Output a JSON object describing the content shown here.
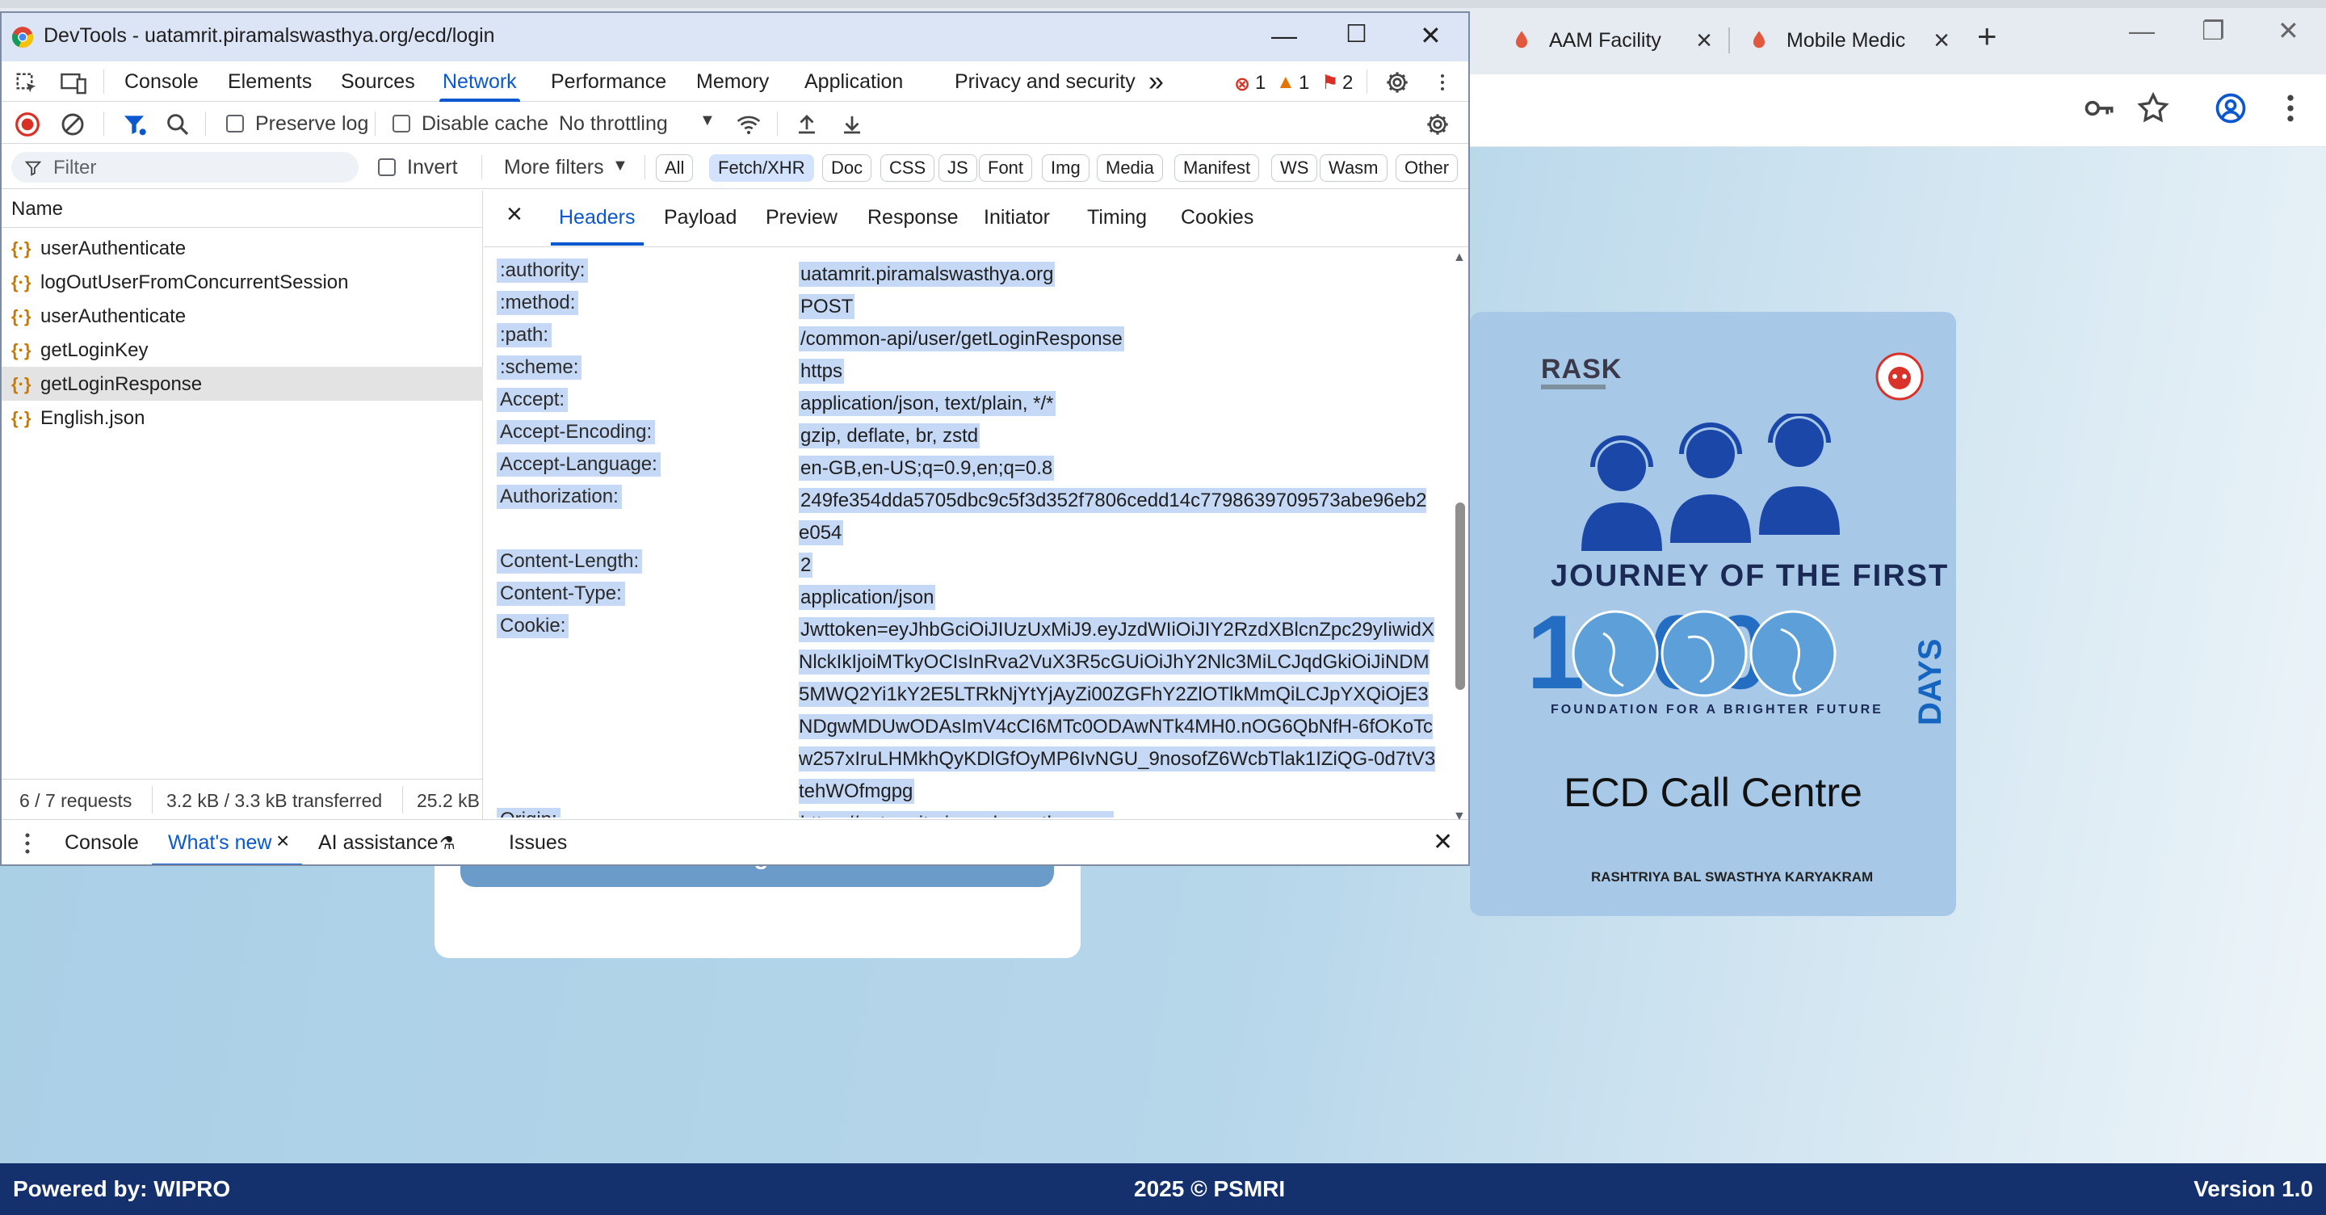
{
  "browser": {
    "tabs": [
      {
        "label": "AAM Facility"
      },
      {
        "label": "Mobile Medic"
      }
    ],
    "new_tab": "+",
    "win_min": "—",
    "win_restore": "❐",
    "win_close": "✕"
  },
  "page": {
    "login_button": "Login",
    "ecd": {
      "logo_text": "RASK",
      "journey": "JOURNEY OF THE FIRST",
      "number": "1000",
      "days": "DAYS",
      "foundation": "FOUNDATION FOR A BRIGHTER FUTURE",
      "title": "ECD Call Centre",
      "program": "RASHTRIYA BAL SWASTHYA KARYAKRAM"
    },
    "footer": {
      "powered": "Powered by: WIPRO",
      "copyright": "2025 © PSMRI",
      "version": "Version 1.0"
    }
  },
  "devtools": {
    "title": "DevTools - uatamrit.piramalswasthya.org/ecd/login",
    "main_tabs": [
      "Console",
      "Elements",
      "Sources",
      "Network",
      "Performance",
      "Memory",
      "Application",
      "Privacy and security"
    ],
    "more_tabs": "»",
    "errors": "1",
    "warnings": "1",
    "issues": "2",
    "network_bar": {
      "preserve_log": "Preserve log",
      "disable_cache": "Disable cache",
      "throttling": "No throttling"
    },
    "filter_bar": {
      "filter_placeholder": "Filter",
      "invert": "Invert",
      "more_filters": "More filters",
      "chips": [
        "All",
        "Fetch/XHR",
        "Doc",
        "CSS",
        "JS",
        "Font",
        "Img",
        "Media",
        "Manifest",
        "WS",
        "Wasm",
        "Other"
      ]
    },
    "requests": {
      "column": "Name",
      "items": [
        "userAuthenticate",
        "logOutUserFromConcurrentSession",
        "userAuthenticate",
        "getLoginKey",
        "getLoginResponse",
        "English.json"
      ],
      "status": {
        "count": "6 / 7 requests",
        "transferred": "3.2 kB / 3.3 kB transferred",
        "resources": "25.2 kB"
      }
    },
    "detail_tabs": [
      "Headers",
      "Payload",
      "Preview",
      "Response",
      "Initiator",
      "Timing",
      "Cookies"
    ],
    "headers": [
      {
        "name": ":authority:",
        "value": "uatamrit.piramalswasthya.org"
      },
      {
        "name": ":method:",
        "value": "POST"
      },
      {
        "name": ":path:",
        "value": "/common-api/user/getLoginResponse"
      },
      {
        "name": ":scheme:",
        "value": "https"
      },
      {
        "name": "Accept:",
        "value": "application/json, text/plain, */*"
      },
      {
        "name": "Accept-Encoding:",
        "value": "gzip, deflate, br, zstd"
      },
      {
        "name": "Accept-Language:",
        "value": "en-GB,en-US;q=0.9,en;q=0.8"
      },
      {
        "name": "Authorization:",
        "value": "249fe354dda5705dbc9c5f3d352f7806cedd14c7798639709573abe96eb2e054"
      },
      {
        "name": "Content-Length:",
        "value": "2"
      },
      {
        "name": "Content-Type:",
        "value": "application/json"
      },
      {
        "name": "Cookie:",
        "value": "Jwttoken=eyJhbGciOiJIUzUxMiJ9.eyJzdWIiOiJIY2RzdXBlcnZpc29yIiwidXNlckIkIjoiMTkyOCIsInRva2VuX3R5cGUiOiJhY2Nlc3MiLCJqdGkiOiJiNDM5MWQ2Yi1kY2E5LTRkNjYtYjAyZi00ZGFhY2ZlOTlkMmQiLCJpYXQiOjE3NDgwMDUwODAsImV4cCI6MTc0ODAwNTk4MH0.nOG6QbNfH-6fOKoTcw257xIruLHMkhQyKDlGfOyMP6IvNGU_9nosofZ6WcbTlak1IZiQG-0d7tV3tehWOfmgpg"
      },
      {
        "name": "Origin:",
        "value": "https://uatamrit.piramalswasthya.org"
      }
    ],
    "drawer": {
      "tabs": [
        "Console",
        "What's new",
        "AI assistance",
        "Issues"
      ],
      "close": "✕"
    }
  }
}
